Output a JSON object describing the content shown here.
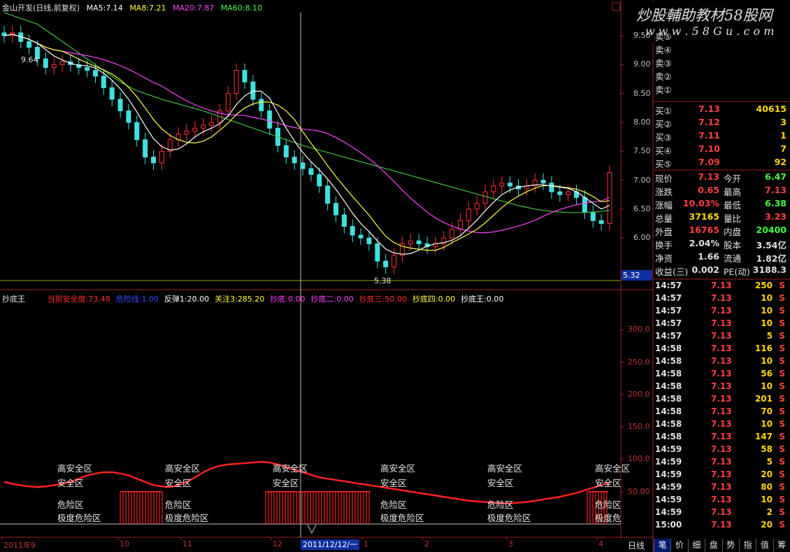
{
  "header": {
    "stock": "金山开发(日线,前复权)",
    "ma5": "MA5:7.14",
    "ma8": "MA8:7.21",
    "ma20": "MA20:7.87",
    "ma60": "MA60:8.10"
  },
  "watermark": {
    "line1": "炒股輔助教材58股网",
    "line2": "w w w . 5 8 G u . c o m"
  },
  "price_axis": [
    "9.50",
    "9.00",
    "8.50",
    "8.00",
    "7.50",
    "7.00",
    "6.50",
    "6.00"
  ],
  "price_marks": {
    "high": "9.64",
    "low": "5.38",
    "cursor_value": "5.32"
  },
  "indicator": {
    "name": "抄底王",
    "items": [
      {
        "text": "当前安全度:73.48",
        "color": "#ff3030"
      },
      {
        "text": "危险线:1.00",
        "color": "#3050ff"
      },
      {
        "text": "反弹1:20.00",
        "color": "#ffffff"
      },
      {
        "text": "关注3:285.20",
        "color": "#ffff40"
      },
      {
        "text": "抄底:0.00",
        "color": "#ff40ff"
      },
      {
        "text": "抄底二:0.00",
        "color": "#ff40ff"
      },
      {
        "text": "抄底三:50.00",
        "color": "#ff3030"
      },
      {
        "text": "抄底四:0.00",
        "color": "#ffff40"
      },
      {
        "text": "抄底王:0.00",
        "color": "#ffffff"
      }
    ],
    "axis": [
      "300.0",
      "250.0",
      "200.0",
      "150.0",
      "100.0",
      "50.00"
    ],
    "zones": {
      "high": "高安全区",
      "safe": "安全区",
      "danger": "危险区",
      "extreme": "极度危险区",
      "extreme_cut": "极度危"
    }
  },
  "x_axis": {
    "labels": [
      "2011年9",
      "10",
      "11",
      "12",
      "1",
      "2",
      "3",
      "4"
    ],
    "cursor_date": "2011/12/12/一",
    "period": "日线"
  },
  "orderbook": {
    "asks": [
      "卖⑤",
      "卖④",
      "卖③",
      "卖②",
      "卖①"
    ],
    "bids": [
      {
        "label": "买①",
        "price": "7.13",
        "vol": "40615"
      },
      {
        "label": "买②",
        "price": "7.12",
        "vol": "3"
      },
      {
        "label": "买③",
        "price": "7.11",
        "vol": "1"
      },
      {
        "label": "买④",
        "price": "7.10",
        "vol": "7"
      },
      {
        "label": "买⑤",
        "price": "7.09",
        "vol": "92"
      }
    ]
  },
  "quote": [
    {
      "l1": "现价",
      "v1": "7.13",
      "c1": "#ff4040",
      "l2": "今开",
      "v2": "6.47",
      "c2": "#40ff40"
    },
    {
      "l1": "涨跌",
      "v1": "0.65",
      "c1": "#ff4040",
      "l2": "最高",
      "v2": "7.13",
      "c2": "#ff4040"
    },
    {
      "l1": "涨幅",
      "v1": "10.03%",
      "c1": "#ff4040",
      "l2": "最低",
      "v2": "6.38",
      "c2": "#40ff40"
    },
    {
      "l1": "总量",
      "v1": "37165",
      "c1": "#ffd700",
      "l2": "量比",
      "v2": "3.23",
      "c2": "#ff4040"
    },
    {
      "l1": "外盘",
      "v1": "16765",
      "c1": "#ff4040",
      "l2": "内盘",
      "v2": "20400",
      "c2": "#40ff40"
    },
    {
      "l1": "换手",
      "v1": "2.04%",
      "c1": "#e0e0e0",
      "l2": "股本",
      "v2": "3.54亿",
      "c2": "#e0e0e0"
    },
    {
      "l1": "净资",
      "v1": "1.66",
      "c1": "#e0e0e0",
      "l2": "流通",
      "v2": "1.82亿",
      "c2": "#e0e0e0"
    },
    {
      "l1": "收益(三)",
      "v1": "0.002",
      "c1": "#e0e0e0",
      "l2": "PE(动)",
      "v2": "3188.3",
      "c2": "#e0e0e0"
    }
  ],
  "ticks": [
    {
      "t": "14:57",
      "p": "7.13",
      "v": "250",
      "s": "S"
    },
    {
      "t": "14:57",
      "p": "7.13",
      "v": "10",
      "s": "S"
    },
    {
      "t": "14:57",
      "p": "7.13",
      "v": "10",
      "s": "S"
    },
    {
      "t": "14:57",
      "p": "7.13",
      "v": "10",
      "s": "S"
    },
    {
      "t": "14:57",
      "p": "7.13",
      "v": "5",
      "s": "S"
    },
    {
      "t": "14:58",
      "p": "7.13",
      "v": "116",
      "s": "S"
    },
    {
      "t": "14:58",
      "p": "7.13",
      "v": "10",
      "s": "S"
    },
    {
      "t": "14:58",
      "p": "7.13",
      "v": "56",
      "s": "S"
    },
    {
      "t": "14:58",
      "p": "7.13",
      "v": "10",
      "s": "S"
    },
    {
      "t": "14:58",
      "p": "7.13",
      "v": "201",
      "s": "S"
    },
    {
      "t": "14:58",
      "p": "7.13",
      "v": "70",
      "s": "S"
    },
    {
      "t": "14:58",
      "p": "7.13",
      "v": "10",
      "s": "S"
    },
    {
      "t": "14:58",
      "p": "7.13",
      "v": "147",
      "s": "S"
    },
    {
      "t": "14:59",
      "p": "7.13",
      "v": "58",
      "s": "S"
    },
    {
      "t": "14:59",
      "p": "7.13",
      "v": "5",
      "s": "S"
    },
    {
      "t": "14:59",
      "p": "7.13",
      "v": "20",
      "s": "S"
    },
    {
      "t": "14:59",
      "p": "7.13",
      "v": "80",
      "s": "S"
    },
    {
      "t": "14:59",
      "p": "7.13",
      "v": "10",
      "s": "S"
    },
    {
      "t": "14:59",
      "p": "7.13",
      "v": "2",
      "s": "S"
    },
    {
      "t": "15:00",
      "p": "7.13",
      "v": "20",
      "s": "S"
    }
  ],
  "tabs": [
    "笔",
    "价",
    "细",
    "盘",
    "势",
    "指",
    "值",
    "筹"
  ],
  "chart_data": {
    "type": "candlestick",
    "ylim": [
      5.3,
      9.9
    ],
    "x_labels": [
      "2011年9",
      "10",
      "11",
      "12",
      "1",
      "2",
      "3",
      "4"
    ],
    "ma_series": [
      "MA5",
      "MA8",
      "MA20",
      "MA60"
    ],
    "close": [
      9.5,
      9.55,
      9.4,
      9.3,
      9.1,
      8.95,
      9.0,
      9.05,
      9.0,
      8.95,
      8.9,
      8.8,
      8.6,
      8.4,
      8.2,
      8.0,
      7.7,
      7.4,
      7.3,
      7.5,
      7.7,
      7.8,
      7.85,
      7.9,
      7.95,
      8.0,
      8.2,
      8.5,
      8.9,
      8.7,
      8.4,
      8.2,
      7.9,
      7.6,
      7.4,
      7.3,
      7.2,
      7.1,
      6.9,
      6.6,
      6.4,
      6.2,
      6.05,
      6.0,
      5.9,
      5.6,
      5.5,
      5.7,
      5.9,
      5.95,
      5.9,
      5.85,
      5.9,
      6.0,
      6.15,
      6.3,
      6.5,
      6.6,
      6.8,
      6.9,
      6.95,
      6.9,
      6.85,
      6.9,
      7.0,
      6.95,
      6.8,
      6.75,
      6.8,
      6.7,
      6.45,
      6.3,
      6.25,
      7.13
    ],
    "ma60": [
      9.9,
      9.85,
      9.8,
      9.75,
      9.7,
      9.6,
      9.5,
      9.4,
      9.3,
      9.2,
      9.1,
      9.0,
      8.9,
      8.8,
      8.7,
      8.62,
      8.55,
      8.5,
      8.45,
      8.4,
      8.36,
      8.32,
      8.28,
      8.24,
      8.2,
      8.15,
      8.1,
      8.05,
      8.0,
      7.95,
      7.9,
      7.85,
      7.8,
      7.75,
      7.7,
      7.65,
      7.6,
      7.56,
      7.52,
      7.48,
      7.44,
      7.4,
      7.36,
      7.32,
      7.28,
      7.24,
      7.2,
      7.16,
      7.12,
      7.08,
      7.04,
      7.0,
      6.96,
      6.92,
      6.88,
      6.84,
      6.8,
      6.76,
      6.72,
      6.68,
      6.64,
      6.6,
      6.56,
      6.53,
      6.5,
      6.48,
      6.46,
      6.45,
      6.44,
      6.44,
      6.44,
      6.45,
      6.46,
      6.48
    ],
    "indicator_ylim": [
      0,
      350
    ],
    "safety": [
      65,
      62,
      60,
      58,
      57,
      58,
      60,
      62,
      65,
      70,
      75,
      78,
      80,
      80,
      78,
      75,
      70,
      65,
      60,
      58,
      57,
      60,
      65,
      72,
      80,
      86,
      90,
      92,
      93,
      94,
      95,
      96,
      95,
      92,
      88,
      84,
      80,
      76,
      72,
      70,
      68,
      66,
      64,
      62,
      60,
      58,
      56,
      54,
      52,
      50,
      48,
      46,
      44,
      42,
      40,
      38,
      36,
      35,
      34,
      33,
      32,
      32,
      33,
      34,
      36,
      38,
      40,
      42,
      45,
      48,
      52,
      56,
      60,
      64
    ]
  }
}
